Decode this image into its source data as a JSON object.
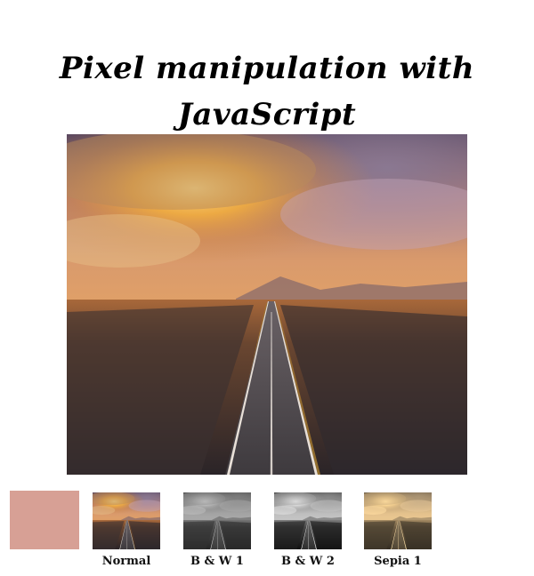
{
  "page": {
    "title_line1": "Pixel manipulation with",
    "title_line2": "JavaScript"
  },
  "main_image": {
    "subject": "road-landscape-photo"
  },
  "color_swatch": {
    "color": "#d7a095"
  },
  "filters": [
    {
      "label": "Normal",
      "filter": "none"
    },
    {
      "label": "B & W 1",
      "filter": "grayscale"
    },
    {
      "label": "B & W 2",
      "filter": "grayscale-contrast"
    },
    {
      "label": "Sepia 1",
      "filter": "sepia"
    }
  ]
}
